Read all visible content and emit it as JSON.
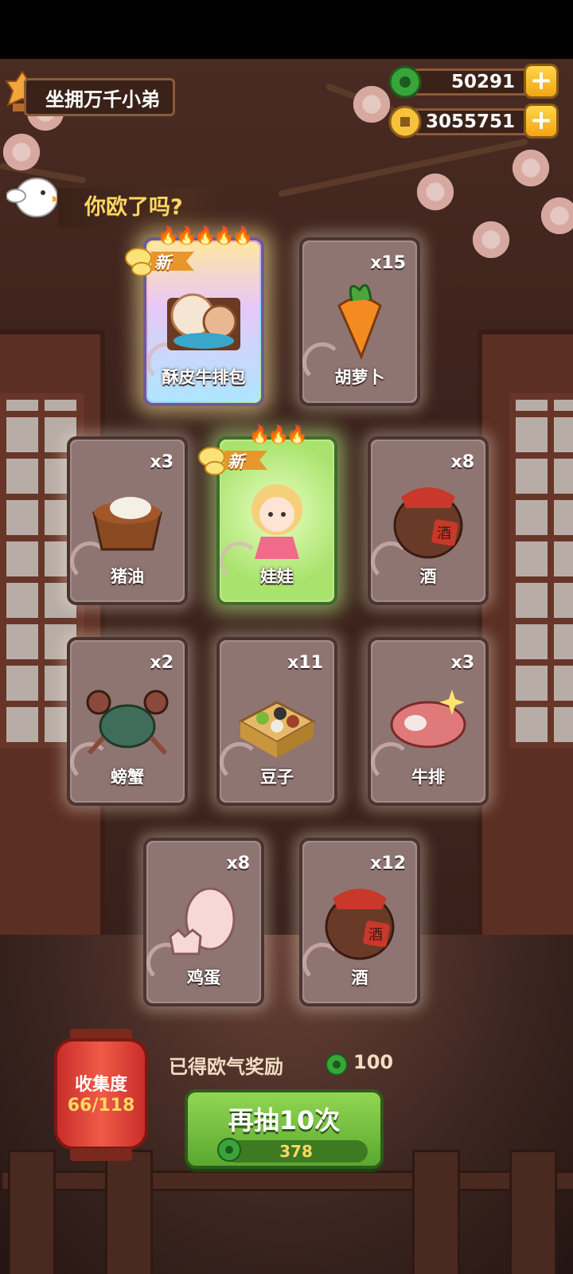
{
  "header": {
    "title": "坐拥万千小弟",
    "currencies": [
      {
        "icon": "jade-gem-icon",
        "value": "50291"
      },
      {
        "icon": "gold-coin-icon",
        "value": "3055751"
      }
    ]
  },
  "bubble": {
    "text": "你欧了吗?"
  },
  "new_label": "新",
  "cards": [
    {
      "name": "酥皮牛排包",
      "count": "",
      "rarity": "rainbow",
      "flames": "🔥🔥🔥🔥🔥",
      "is_new": true,
      "icon": "pastry-steak-bun-icon"
    },
    {
      "name": "胡萝卜",
      "count": "x15",
      "rarity": "normal",
      "flames": "",
      "is_new": false,
      "icon": "carrot-icon"
    },
    {
      "name": "猪油",
      "count": "x3",
      "rarity": "normal",
      "flames": "",
      "is_new": false,
      "icon": "lard-bowl-icon"
    },
    {
      "name": "娃娃",
      "count": "",
      "rarity": "green",
      "flames": "🔥🔥🔥",
      "is_new": true,
      "icon": "doll-girl-icon"
    },
    {
      "name": "酒",
      "count": "x8",
      "rarity": "normal",
      "flames": "",
      "is_new": false,
      "icon": "wine-jar-icon"
    },
    {
      "name": "螃蟹",
      "count": "x2",
      "rarity": "normal",
      "flames": "",
      "is_new": false,
      "icon": "crab-icon"
    },
    {
      "name": "豆子",
      "count": "x11",
      "rarity": "normal",
      "flames": "",
      "is_new": false,
      "icon": "beans-box-icon"
    },
    {
      "name": "牛排",
      "count": "x3",
      "rarity": "normal",
      "flames": "",
      "is_new": false,
      "icon": "steak-icon"
    },
    {
      "name": "鸡蛋",
      "count": "x8",
      "rarity": "normal",
      "flames": "",
      "is_new": false,
      "icon": "eggs-icon"
    },
    {
      "name": "酒",
      "count": "x12",
      "rarity": "normal",
      "flames": "",
      "is_new": false,
      "icon": "wine-jar-icon"
    }
  ],
  "jar_label": "酒",
  "collection": {
    "label": "收集度",
    "value": "66/118"
  },
  "reward": {
    "label": "已得欧气奖励",
    "value": "100"
  },
  "draw_button": {
    "label": "再抽10次",
    "cost": "378"
  },
  "colors": {
    "accent_gold": "#ffd763",
    "button_green": "#5aa82f",
    "lantern_red": "#c92d2a"
  }
}
